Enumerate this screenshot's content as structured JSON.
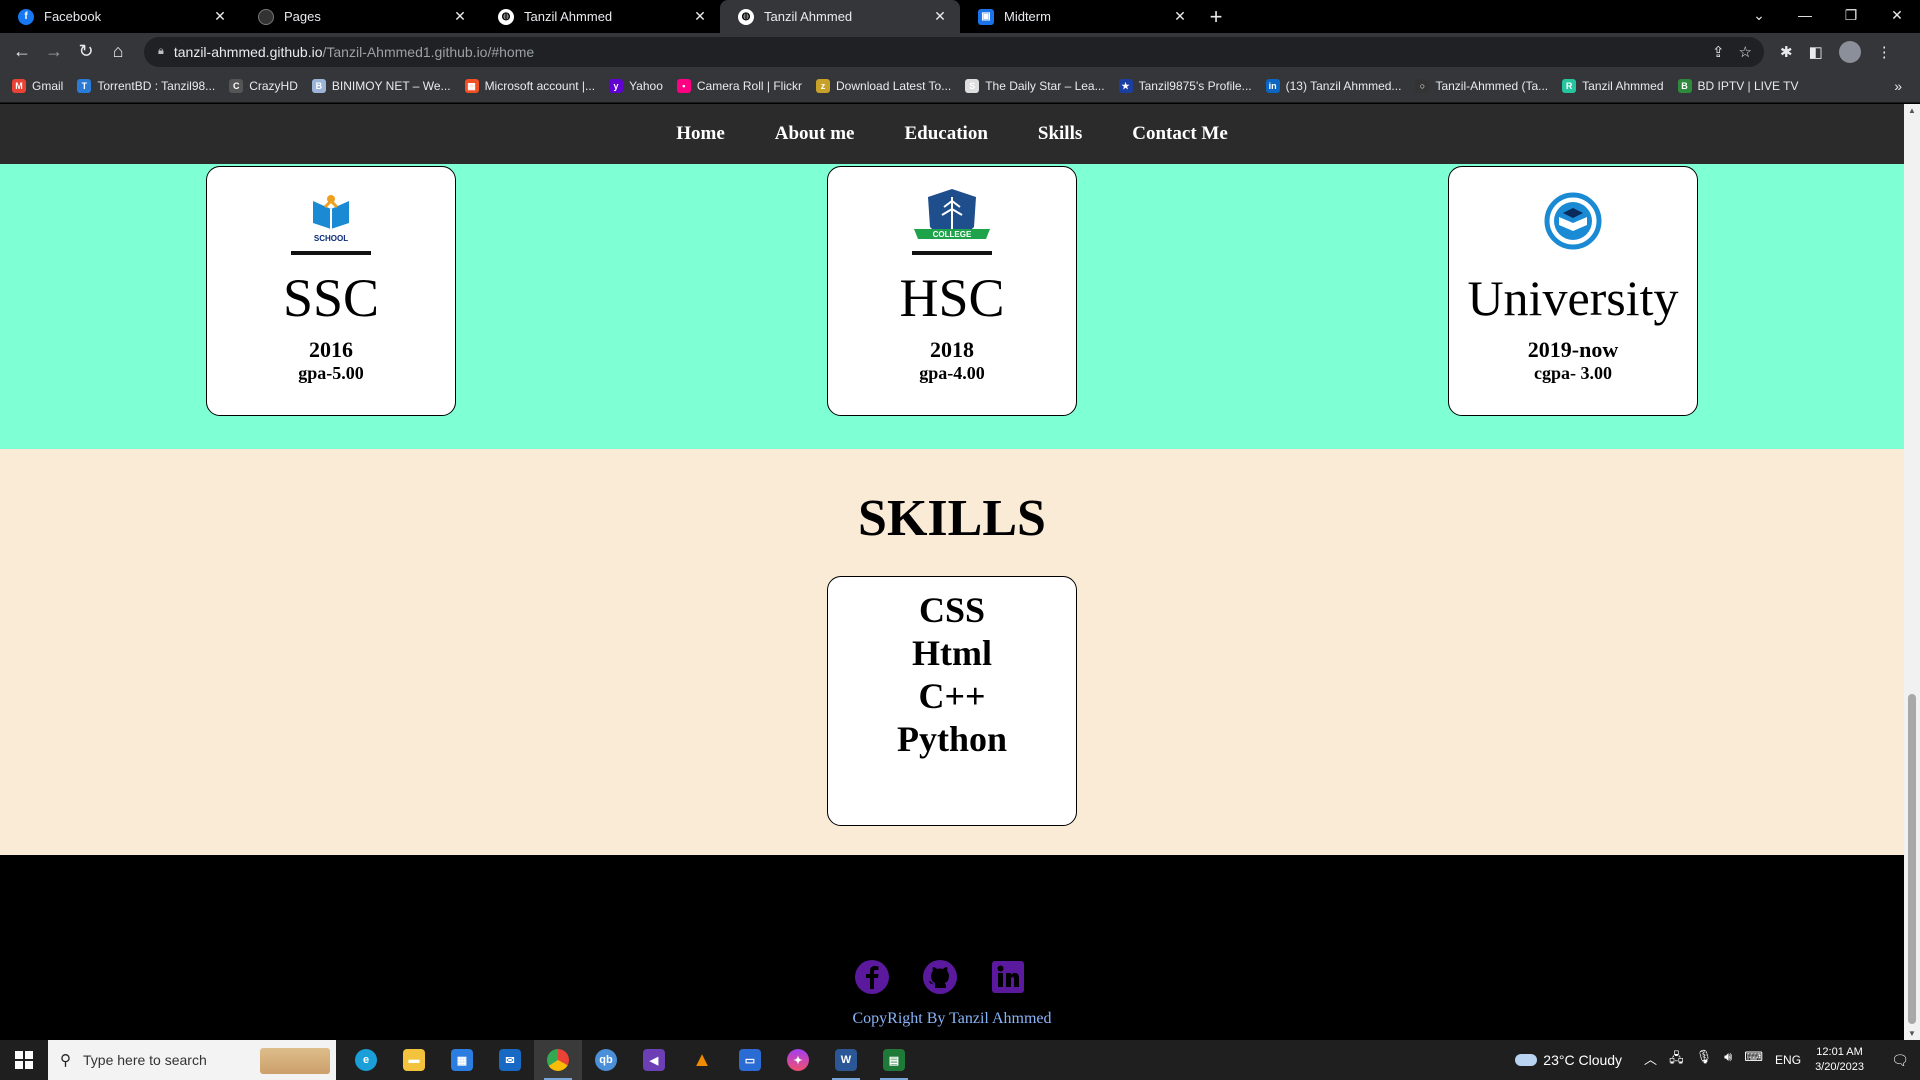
{
  "tabs": [
    {
      "title": "Facebook",
      "icon": "facebook-icon",
      "color": "#1877f2"
    },
    {
      "title": "Pages",
      "icon": "github-icon",
      "color": "#333"
    },
    {
      "title": "Tanzil Ahmmed",
      "icon": "globe-icon",
      "color": "#555"
    },
    {
      "title": "Tanzil Ahmmed",
      "icon": "globe-icon",
      "color": "#555"
    },
    {
      "title": "Midterm",
      "icon": "classroom-icon",
      "color": "#1a73e8"
    }
  ],
  "address": {
    "host": "tanzil-ahmmed.github.io",
    "path": "/Tanzil-Ahmmed1.github.io/#home"
  },
  "bookmarks": [
    {
      "label": "Gmail",
      "color": "#ea4335",
      "glyph": "M"
    },
    {
      "label": "TorrentBD : Tanzil98...",
      "color": "#2b7bd6",
      "glyph": "T"
    },
    {
      "label": "CrazyHD",
      "color": "#555",
      "glyph": "C"
    },
    {
      "label": "BINIMOY NET – We...",
      "color": "#9bb4d8",
      "glyph": "B"
    },
    {
      "label": "Microsoft account |...",
      "color": "#f25022",
      "glyph": "▦"
    },
    {
      "label": "Yahoo",
      "color": "#6001d2",
      "glyph": "y"
    },
    {
      "label": "Camera Roll | Flickr",
      "color": "#ff0084",
      "glyph": "•"
    },
    {
      "label": "Download Latest To...",
      "color": "#c8a12a",
      "glyph": "z"
    },
    {
      "label": "The Daily Star – Lea...",
      "color": "#ddd",
      "glyph": "S"
    },
    {
      "label": "Tanzil9875's Profile...",
      "color": "#1b3fa0",
      "glyph": "★"
    },
    {
      "label": "(13) Tanzil Ahmmed...",
      "color": "#0a66c2",
      "glyph": "in"
    },
    {
      "label": "Tanzil-Ahmmed (Ta...",
      "color": "#333",
      "glyph": "○"
    },
    {
      "label": "Tanzil Ahmmed",
      "color": "#27c4a0",
      "glyph": "R"
    },
    {
      "label": "BD IPTV | LIVE TV",
      "color": "#2e8b3e",
      "glyph": "B"
    }
  ],
  "nav": [
    "Home",
    "About me",
    "Education",
    "Skills",
    "Contact Me"
  ],
  "education": [
    {
      "degree": "SSC",
      "year": "2016",
      "gpa": "gpa-5.00",
      "logo": "school-logo-icon",
      "logo_text": "SCHOOL"
    },
    {
      "degree": "HSC",
      "year": "2018",
      "gpa": "gpa-4.00",
      "logo": "college-logo-icon",
      "logo_text": "COLLEGE"
    },
    {
      "degree": "University",
      "year": "2019-now",
      "gpa": "cgpa- 3.00",
      "logo": "university-logo-icon"
    }
  ],
  "skills": {
    "heading": "SKILLS",
    "items": [
      "CSS",
      "Html",
      "C++",
      "Python"
    ]
  },
  "footer": {
    "social": [
      "facebook-icon",
      "github-icon",
      "linkedin-icon"
    ],
    "social_color": "#5b1a9e",
    "copyright": "CopyRight By Tanzil Ahmmed"
  },
  "colors": {
    "edu_bg": "#7fffd4",
    "skills_bg": "#faebd7",
    "nav_bg": "#2b2b2b"
  },
  "taskbar": {
    "search_placeholder": "Type here to search",
    "weather": "23°C  Cloudy",
    "lang": "ENG",
    "time": "12:01 AM",
    "date": "3/20/2023"
  }
}
